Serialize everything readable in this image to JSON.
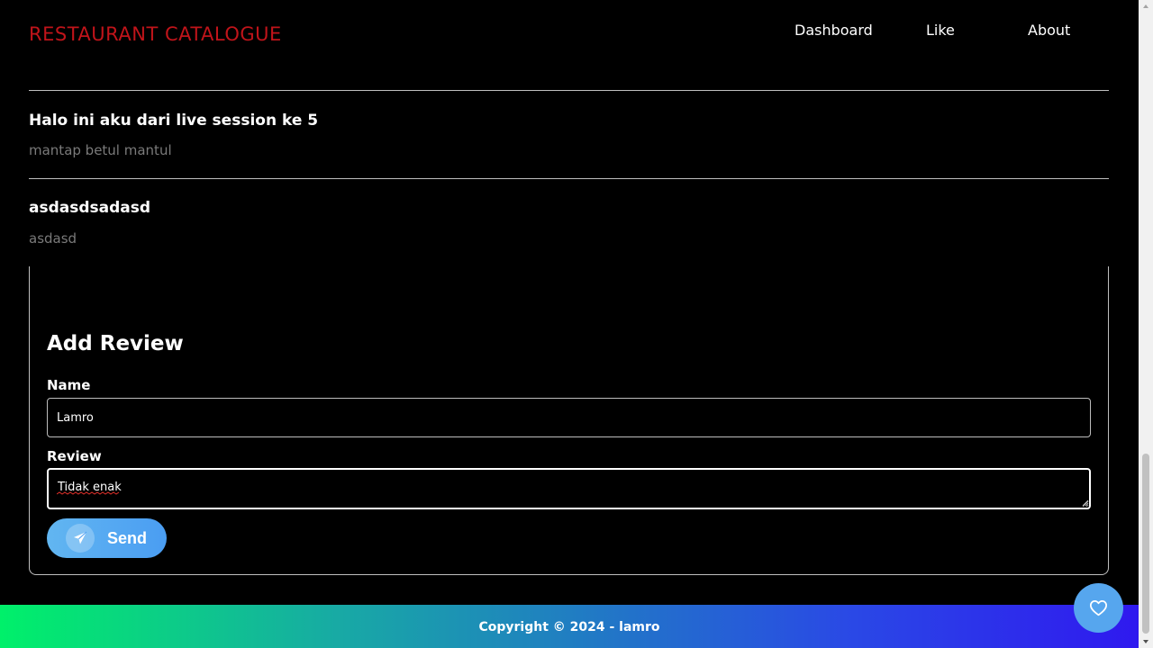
{
  "header": {
    "brand": "RESTAURANT CATALOGUE",
    "nav": [
      {
        "label": "Dashboard"
      },
      {
        "label": "Like"
      },
      {
        "label": "About"
      }
    ]
  },
  "reviews": [
    {
      "name": "Halo ini aku dari live session ke 5",
      "text": "mantap betul mantul"
    },
    {
      "name": "asdasdsadasd",
      "text": "asdasd"
    }
  ],
  "form": {
    "title": "Add Review",
    "name_label": "Name",
    "name_value": "Lamro",
    "review_label": "Review",
    "review_value": "Tidak enak",
    "send_label": "Send"
  },
  "footer": {
    "text": "Copyright © 2024 - lamro"
  },
  "icons": {
    "send": "send-icon",
    "fab": "heart-icon"
  },
  "colors": {
    "brand": "#c0141a",
    "button": "#4a9df2",
    "footer_start": "#00f06a",
    "footer_end": "#2f19ef"
  }
}
